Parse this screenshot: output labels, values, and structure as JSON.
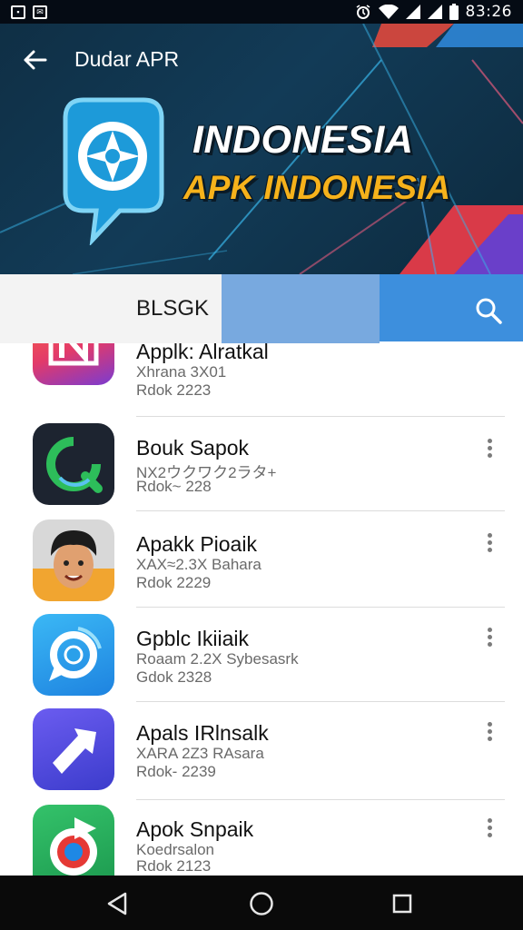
{
  "status_bar": {
    "left_icons": [
      "gallery-icon",
      "message-icon"
    ],
    "right_icons": [
      "alarm-icon",
      "wifi-icon",
      "signal-icon",
      "signal-icon",
      "battery-icon"
    ],
    "time": "83:26"
  },
  "header": {
    "title": "Dudar APR",
    "back_icon": "arrow-left-icon"
  },
  "banner": {
    "line1": "INDONESIA",
    "line2": "APK INDONESIA",
    "logo_icon": "chat-bubble-logo-icon"
  },
  "search": {
    "value": "BLSGK",
    "button_icon": "search-icon"
  },
  "apps": [
    {
      "name": "Applk: Alratkal",
      "sub1": "Xhrana 3X01",
      "sub2": "Rdok 2223",
      "icon": "n-logo-icon",
      "has_menu": false
    },
    {
      "name": "Bouk Sapok",
      "sub1": "NX2ウクワク2ラタ+",
      "sub2": "Rdok~ 228",
      "icon": "refresh-ring-icon",
      "has_menu": true
    },
    {
      "name": "Apakk Pioaik",
      "sub1": "XAX≈2.3X Bahara",
      "sub2": "Rdok 2229",
      "icon": "avatar-face-icon",
      "has_menu": true
    },
    {
      "name": "Gpblc Ikiiaik",
      "sub1": "Roaam 2.2X Sybesasrk",
      "sub2": "Gdok 2328",
      "icon": "chat-ring-icon",
      "has_menu": true
    },
    {
      "name": "Apals IRlnsalk",
      "sub1": "XARA 2Z3 RAsara",
      "sub2": "Rdok- 2239",
      "icon": "arrow-share-icon",
      "has_menu": true
    },
    {
      "name": "Apok Snpaik",
      "sub1": "Koedrsalon",
      "sub2": "Rdok 2123",
      "icon": "target-flag-icon",
      "has_menu": true
    }
  ],
  "nav_bar": {
    "icons": [
      "back-triangle-icon",
      "home-circle-icon",
      "recents-square-icon"
    ]
  },
  "colors": {
    "banner_bg": "#123b57",
    "accent_blue": "#3d8fdd",
    "accent_yellow": "#f6b21b"
  }
}
